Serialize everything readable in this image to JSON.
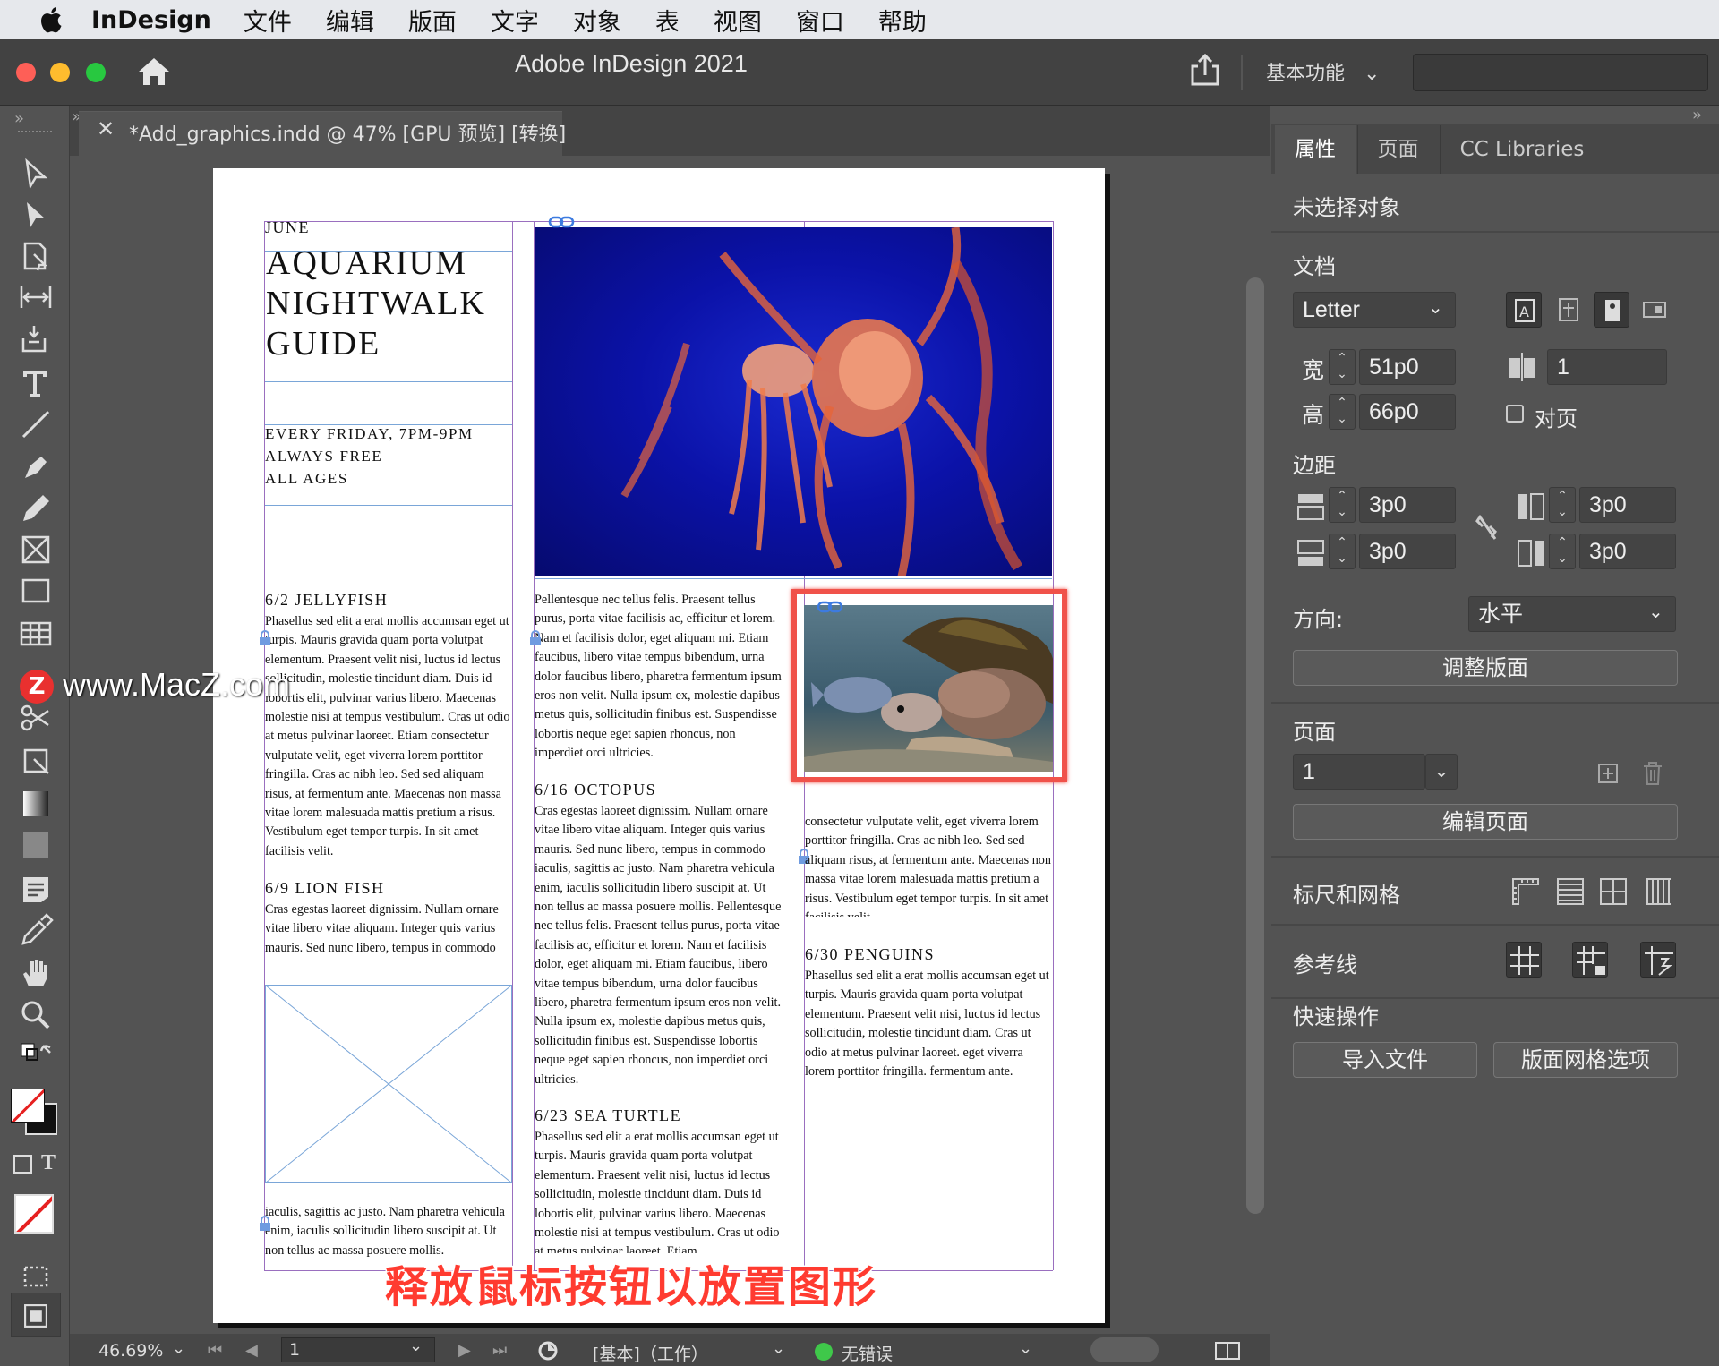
{
  "menubar": {
    "app": "InDesign",
    "items": [
      "文件",
      "编辑",
      "版面",
      "文字",
      "对象",
      "表",
      "视图",
      "窗口",
      "帮助"
    ]
  },
  "window": {
    "title": "Adobe InDesign 2021",
    "workspace": "基本功能"
  },
  "document_tab": {
    "label": "*Add_graphics.indd @ 47% [GPU 预览] [转换]"
  },
  "page": {
    "month": "JUNE",
    "title_lines": [
      "AQUARIUM",
      "NIGHTWALK",
      "GUIDE"
    ],
    "info_lines": [
      "EVERY FRIDAY, 7PM-9PM",
      "ALWAYS FREE",
      "ALL AGES"
    ],
    "col1": {
      "h1": "6/2 JELLYFISH",
      "p1": "Phasellus sed elit a erat mollis accumsan eget ut turpis. Mauris gravida quam porta volutpat elementum. Praesent velit nisi, luctus id lectus sollicitudin, molestie tincidunt diam. Duis id lobortis elit, pulvinar varius libero. Maecenas molestie nisi at tempus vestibulum. Cras ut odio at metus pulvinar laoreet. Etiam consectetur vulputate velit, eget viverra lorem porttitor fringilla. Cras ac nibh leo. Sed sed aliquam risus, at fermentum ante. Maecenas non massa vitae lorem malesuada mattis pretium a risus. Vestibulum eget tempor turpis. In sit amet facilisis velit.",
      "h2": "6/9 LION FISH",
      "p2": "Cras egestas laoreet dignissim. Nullam ornare vitae libero vitae aliquam. Integer quis varius mauris. Sed nunc libero, tempus in commodo",
      "p3": "iaculis, sagittis ac justo. Nam pharetra vehicula enim, iaculis sollicitudin libero suscipit at. Ut non tellus ac massa posuere mollis."
    },
    "col2": {
      "p1": "Pellentesque nec tellus felis. Praesent tellus purus, porta vitae facilisis ac, efficitur et lorem. Nam et facilisis dolor, eget aliquam mi. Etiam faucibus, libero vitae tempus bibendum, urna dolor faucibus libero, pharetra fermentum ipsum eros non velit. Nulla ipsum ex, molestie dapibus metus quis, sollicitudin finibus est. Suspendisse lobortis neque eget sapien rhoncus, non imperdiet orci ultricies.",
      "h1": "6/16 OCTOPUS",
      "p2": "Cras egestas laoreet dignissim. Nullam ornare vitae libero vitae aliquam. Integer quis varius mauris. Sed nunc libero, tempus in commodo iaculis, sagittis ac justo. Nam pharetra vehicula enim, iaculis sollicitudin libero suscipit at. Ut non tellus ac massa posuere mollis. Pellentesque nec tellus felis. Praesent tellus purus, porta vitae facilisis ac, efficitur et lorem. Nam et facilisis dolor, eget aliquam mi. Etiam faucibus, libero vitae tempus bibendum, urna dolor faucibus libero, pharetra fermentum ipsum eros non velit. Nulla ipsum ex, molestie dapibus metus quis, sollicitudin finibus est. Suspendisse lobortis neque eget sapien rhoncus, non imperdiet orci ultricies.",
      "h2": "6/23 SEA TURTLE",
      "p3": "Phasellus sed elit a erat mollis accumsan eget ut turpis. Mauris gravida quam porta volutpat elementum. Praesent velit nisi, luctus id lectus sollicitudin, molestie tincidunt diam. Duis id lobortis elit, pulvinar varius libero. Maecenas molestie nisi at tempus vestibulum. Cras ut odio at metus pulvinar laoreet. Etiam"
    },
    "col3": {
      "p1": "consectetur vulputate velit, eget viverra lorem porttitor fringilla. Cras ac nibh leo. Sed sed aliquam risus, at fermentum ante. Maecenas non massa vitae lorem malesuada mattis pretium a risus. Vestibulum eget tempor turpis. In sit amet facilisis velit.",
      "h1": "6/30 PENGUINS",
      "p2": "Phasellus sed elit a erat mollis accumsan eget ut turpis. Mauris gravida quam porta volutpat elementum. Praesent velit nisi, luctus id lectus sollicitudin, molestie tincidunt diam. Cras ut odio at metus pulvinar laoreet. eget viverra lorem porttitor fringilla. fermentum ante."
    }
  },
  "status": {
    "zoom": "46.69%",
    "page": "1",
    "preflight_profile": "[基本]（工作）",
    "errors": "无错误"
  },
  "panel": {
    "tabs": [
      "属性",
      "页面",
      "CC Libraries"
    ],
    "selection": "未选择对象",
    "doc_section": "文档",
    "preset": "Letter",
    "width_label": "宽",
    "width": "51p0",
    "height_label": "高",
    "height": "66p0",
    "pages": "1",
    "facing_label": "对页",
    "margin_section": "边距",
    "margin_top": "3p0",
    "margin_bottom": "3p0",
    "margin_inside": "3p0",
    "margin_outside": "3p0",
    "orientation_label": "方向:",
    "orientation": "水平",
    "adjust_layout": "调整版面",
    "page_section": "页面",
    "page_value": "1",
    "edit_page": "编辑页面",
    "rulers_section": "标尺和网格",
    "guides_section": "参考线",
    "quick_section": "快速操作",
    "import_file": "导入文件",
    "layout_grid": "版面网格选项"
  },
  "overlay": {
    "watermark": "www.MacZ.com",
    "caption": "释放鼠标按钮以放置图形"
  },
  "colors": {
    "highlight": "#f0524a",
    "frame": "#9a6fbf",
    "active_green": "#3fc84a"
  }
}
